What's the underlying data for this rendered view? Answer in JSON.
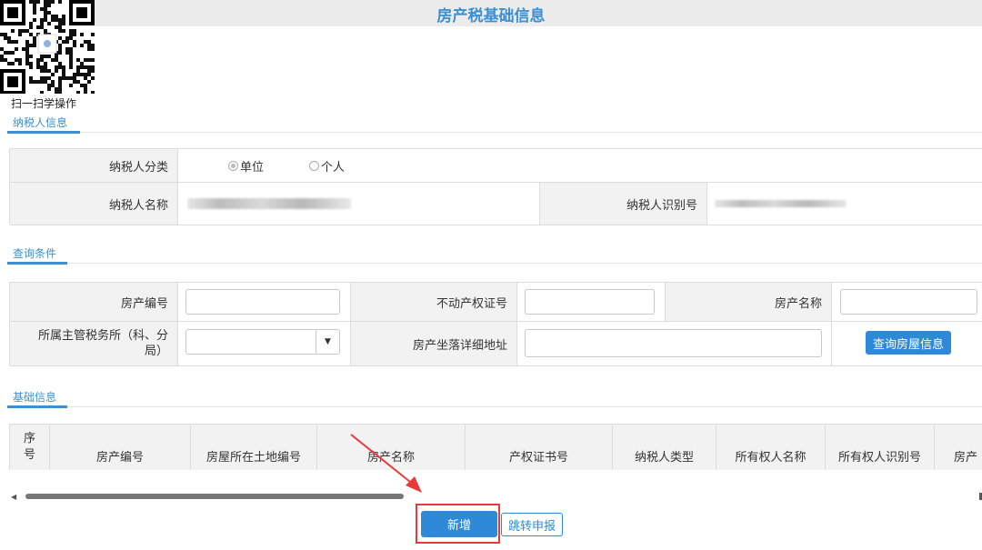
{
  "page": {
    "title": "房产税基础信息"
  },
  "qr": {
    "caption": "扫一扫学操作"
  },
  "sections": {
    "taxpayer": "纳税人信息",
    "query": "查询条件",
    "basic": "基础信息"
  },
  "taxpayer": {
    "category_label": "纳税人分类",
    "options": [
      "单位",
      "个人"
    ],
    "selected": "单位",
    "name_label": "纳税人名称",
    "id_label": "纳税人识别号"
  },
  "query": {
    "house_no_label": "房产编号",
    "cert_no_label": "不动产权证号",
    "house_name_label": "房产名称",
    "office_label": "所属主管税务所（科、分局）",
    "address_label": "房产坐落详细地址",
    "search_button": "查询房屋信息"
  },
  "table": {
    "columns": [
      "序号",
      "房产编号",
      "房屋所在土地编号",
      "房产名称",
      "产权证书号",
      "纳税人类型",
      "所有权人名称",
      "所有权人识别号",
      "房产"
    ]
  },
  "actions": {
    "add_button": "新增",
    "jump_button": "跳转申报"
  },
  "colors": {
    "accent": "#2e8ad8",
    "annotation": "#e83a3a"
  }
}
